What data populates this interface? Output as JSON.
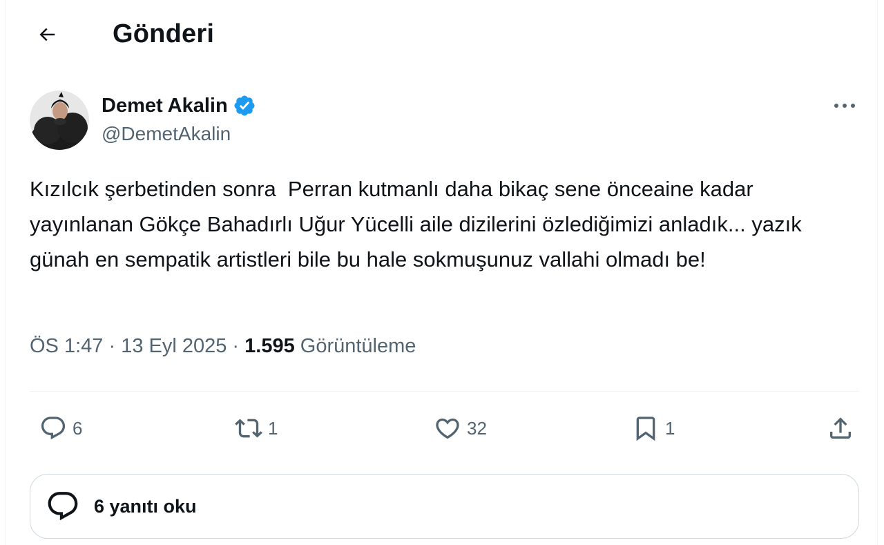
{
  "header": {
    "back_icon": "arrow-left-icon",
    "title": "Gönderi"
  },
  "author": {
    "display_name": "Demet Akalin",
    "handle": "@DemetAkalin",
    "verified": true,
    "verified_color": "#1d9bf0"
  },
  "post": {
    "text": "Kızılcık şerbetinden sonra  Perran kutmanlı daha bikaç sene önceaine kadar yayınlanan Gökçe Bahadırlı Uğur Yücelli aile dizilerini özlediğimizi anladık... yazık günah en sempatik artistleri bile bu hale sokmuşunuz vallahi olmadı be!",
    "time": "ÖS 1:47",
    "separator": " · ",
    "date": "13 Eyl 2025",
    "views_count": "1.595",
    "views_label": " Görüntüleme"
  },
  "actions": {
    "reply": {
      "icon": "reply-icon",
      "count": "6"
    },
    "repost": {
      "icon": "repost-icon",
      "count": "1"
    },
    "like": {
      "icon": "heart-icon",
      "count": "32"
    },
    "bookmark": {
      "icon": "bookmark-icon",
      "count": "1"
    },
    "share": {
      "icon": "share-icon"
    }
  },
  "more_icon": "more-horizontal-icon",
  "read_replies": {
    "icon": "speech-bubble-icon",
    "label": "6 yanıtı oku"
  },
  "colors": {
    "text": "#0f1419",
    "secondary": "#536471",
    "border": "#cfd9de",
    "divider": "#eff3f4",
    "accent": "#1d9bf0"
  }
}
